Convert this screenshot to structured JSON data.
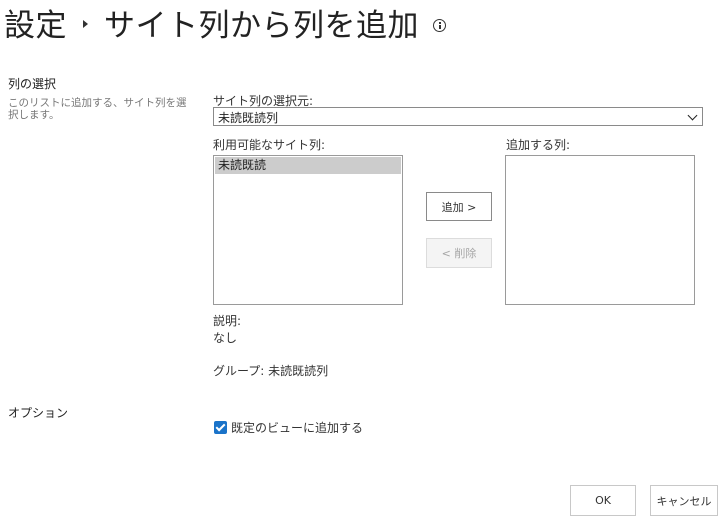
{
  "header": {
    "breadcrumb_parent": "設定",
    "title": "サイト列から列を追加"
  },
  "columns_section": {
    "label": "列の選択",
    "description": "このリストに追加する、サイト列を選択します。"
  },
  "site_column_source": {
    "label": "サイト列の選択元:",
    "selected": "未読既読列"
  },
  "available_columns": {
    "label": "利用可能なサイト列:",
    "items": [
      "未読既読"
    ]
  },
  "columns_to_add": {
    "label": "追加する列:",
    "items": []
  },
  "buttons": {
    "add": "追加 >",
    "remove": "< 削除"
  },
  "details": {
    "description_label": "説明:",
    "description_value": "なし",
    "group_label": "グループ:",
    "group_value": "未読既読列"
  },
  "options_section": {
    "label": "オプション",
    "add_to_default_view_label": "既定のビューに追加する",
    "add_to_default_view_checked": true
  },
  "footer": {
    "ok": "OK",
    "cancel": "キャンセル"
  },
  "colors": {
    "checkbox_accent": "#1a73c9",
    "selected_option_bg": "#cccccc"
  }
}
